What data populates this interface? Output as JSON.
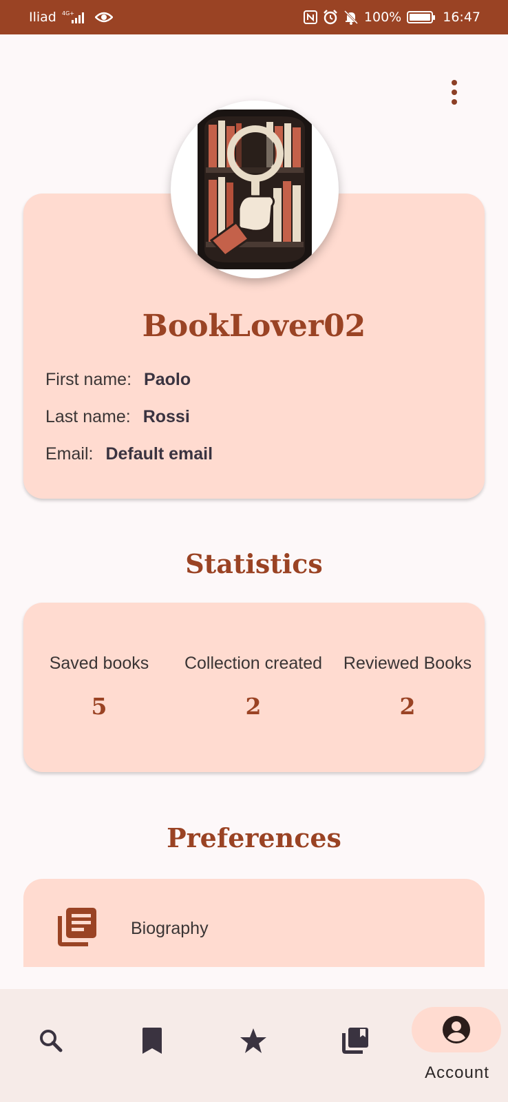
{
  "status_bar": {
    "carrier": "Iliad",
    "network": "4G+",
    "battery": "100%",
    "time": "16:47"
  },
  "profile": {
    "username": "BookLover02",
    "first_name_label": "First name:",
    "first_name": "Paolo",
    "last_name_label": "Last name:",
    "last_name": "Rossi",
    "email_label": "Email:",
    "email": "Default email"
  },
  "statistics": {
    "title": "Statistics",
    "items": [
      {
        "label": "Saved books",
        "value": "5"
      },
      {
        "label": "Collection created",
        "value": "2"
      },
      {
        "label": "Reviewed Books",
        "value": "2"
      }
    ]
  },
  "preferences": {
    "title": "Preferences",
    "items": [
      {
        "label": "Biography",
        "icon": "library-books-icon"
      }
    ]
  },
  "bottom_nav": {
    "items": [
      {
        "icon": "search-icon"
      },
      {
        "icon": "bookmark-icon"
      },
      {
        "icon": "star-icon"
      },
      {
        "icon": "collections-icon"
      },
      {
        "icon": "account-icon",
        "label": "Account",
        "active": true
      }
    ]
  },
  "colors": {
    "primary": "#9a4324",
    "card": "#ffdbd0",
    "background": "#fdf8f9",
    "nav": "#f6ebe8"
  }
}
